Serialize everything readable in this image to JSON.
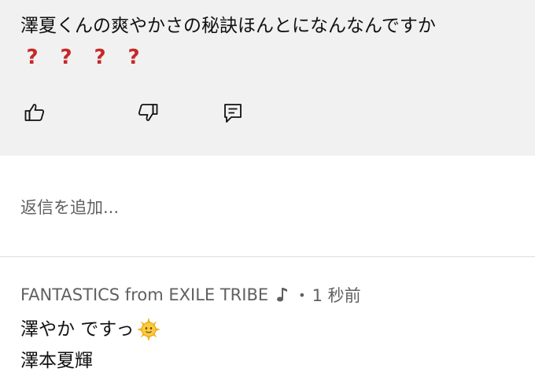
{
  "comment": {
    "text": "澤夏くんの爽やかさの秘訣ほんとになんなんですか",
    "question_marks": [
      "?",
      "?",
      "?",
      "?"
    ],
    "question_mark_color": "#c62828"
  },
  "actions": {
    "like_icon": "thumbs-up-icon",
    "dislike_icon": "thumbs-down-icon",
    "reply_icon": "reply-comment-icon"
  },
  "reply": {
    "placeholder": "返信を追加..."
  },
  "reply_comment": {
    "author": "FANTASTICS from EXILE TRIBE",
    "author_badge_icon": "music-note-icon",
    "separator": "•",
    "timestamp": "1 秒前",
    "line1": "澤やか ですっ",
    "line1_emoji": "sun-with-face-icon",
    "line2": "澤本夏輝"
  }
}
